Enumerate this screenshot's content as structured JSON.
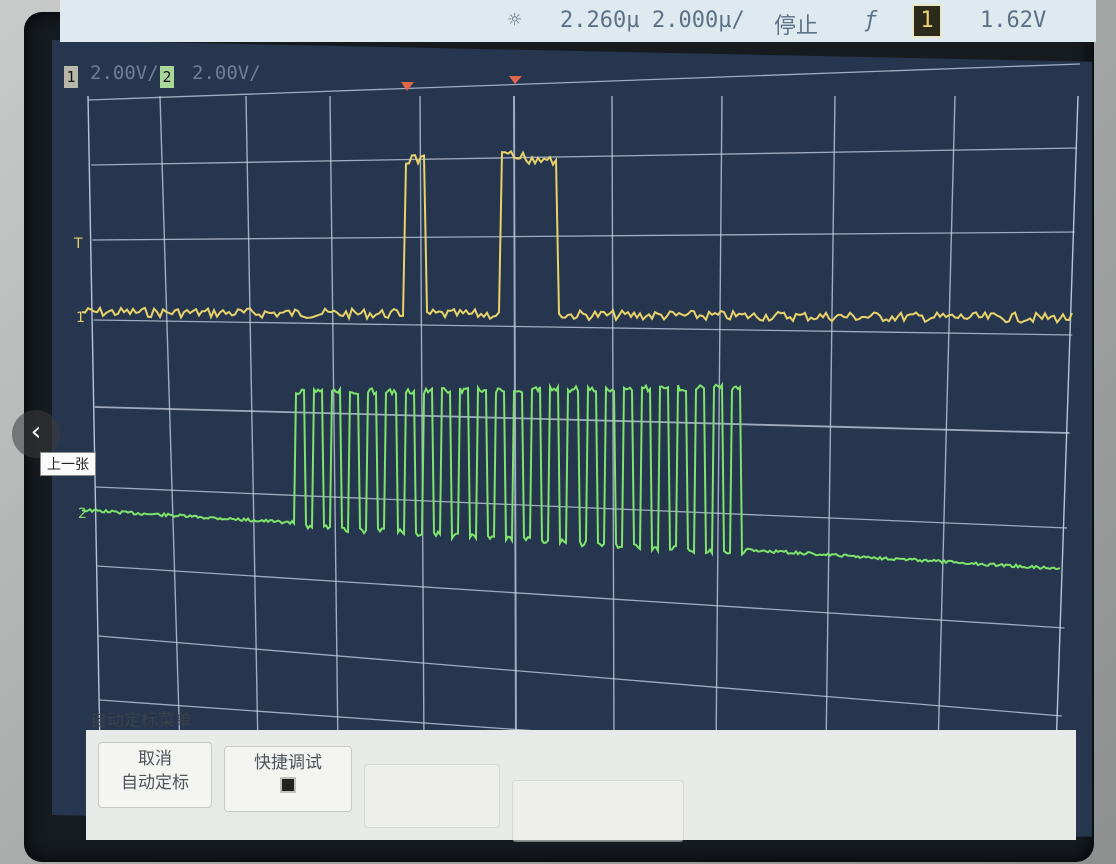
{
  "status": {
    "brightness_icon": "sun-icon",
    "trigger_position": "2.260µ",
    "timebase": "2.000µ/",
    "run_state": "停止",
    "trigger_slope_icon": "rising-edge-icon",
    "trigger_channel": "1",
    "trigger_level": "1.62V"
  },
  "scales": {
    "ch1_label": "1",
    "ch1_scale": "2.00V/",
    "ch2_label": "2",
    "ch2_scale": "2.00V/"
  },
  "markers": {
    "trigger_t": "T",
    "ch1_ground": "1",
    "ch2_ground": "2"
  },
  "menu": {
    "title": "自动定标菜单",
    "cancel_line1": "取消",
    "cancel_line2": "自动定标",
    "quick_label": "快捷调试"
  },
  "viewer": {
    "prev_tooltip": "上一张",
    "prev_icon": "chevron-left-icon"
  },
  "colors": {
    "ch1": "#e8d26a",
    "ch2": "#7fe36b",
    "grid": "#c8d2e6",
    "screen": "#26364e"
  }
}
